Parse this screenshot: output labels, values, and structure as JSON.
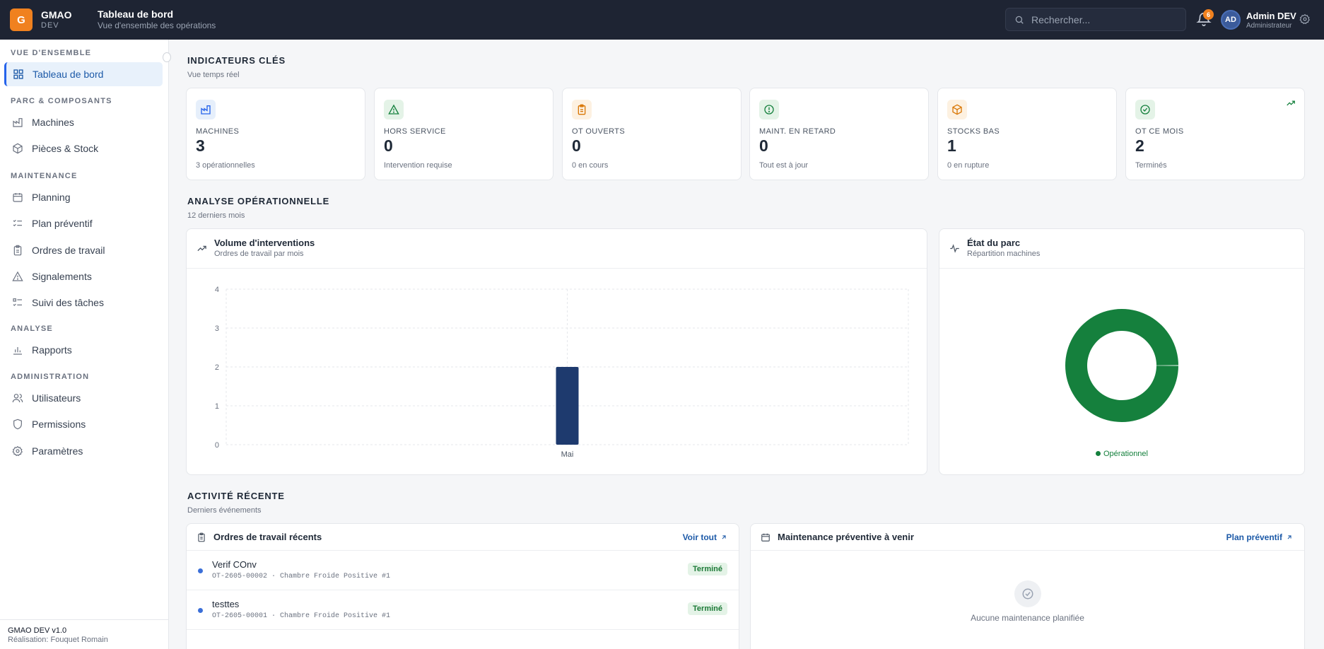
{
  "brand": {
    "logo_letter": "G",
    "name": "GMAO",
    "env": "DEV"
  },
  "header": {
    "title": "Tableau de bord",
    "subtitle": "Vue d'ensemble des opérations"
  },
  "search": {
    "placeholder": "Rechercher..."
  },
  "notifications": {
    "count": "6"
  },
  "user": {
    "initials": "AD",
    "name": "Admin DEV",
    "role": "Administrateur"
  },
  "sidebar": {
    "sections": [
      {
        "title": "VUE D'ENSEMBLE",
        "items": [
          {
            "label": "Tableau de bord",
            "icon": "dashboard-icon",
            "active": true
          }
        ]
      },
      {
        "title": "PARC & COMPOSANTS",
        "items": [
          {
            "label": "Machines",
            "icon": "factory-icon"
          },
          {
            "label": "Pièces & Stock",
            "icon": "box-icon"
          }
        ]
      },
      {
        "title": "MAINTENANCE",
        "items": [
          {
            "label": "Planning",
            "icon": "calendar-icon"
          },
          {
            "label": "Plan préventif",
            "icon": "checklist-icon"
          },
          {
            "label": "Ordres de travail",
            "icon": "clipboard-icon"
          },
          {
            "label": "Signalements",
            "icon": "warning-icon"
          },
          {
            "label": "Suivi des tâches",
            "icon": "tasks-icon"
          }
        ]
      },
      {
        "title": "ANALYSE",
        "items": [
          {
            "label": "Rapports",
            "icon": "bar-chart-icon"
          }
        ]
      },
      {
        "title": "ADMINISTRATION",
        "items": [
          {
            "label": "Utilisateurs",
            "icon": "users-icon"
          },
          {
            "label": "Permissions",
            "icon": "shield-icon"
          },
          {
            "label": "Paramètres",
            "icon": "gear-icon"
          }
        ]
      }
    ],
    "footer": {
      "version": "GMAO DEV v1.0",
      "credit": "Réalisation: Fouquet Romain"
    }
  },
  "kpi_section": {
    "title": "INDICATEURS CLÉS",
    "subtitle": "Vue temps réel"
  },
  "kpis": [
    {
      "label": "MACHINES",
      "value": "3",
      "sub": "3 opérationnelles",
      "icon": "factory-icon",
      "color": "#2563eb",
      "bg": "#e6effb"
    },
    {
      "label": "HORS SERVICE",
      "value": "0",
      "sub": "Intervention requise",
      "icon": "warning-icon",
      "color": "#15803d",
      "bg": "#e4f3e7"
    },
    {
      "label": "OT OUVERTS",
      "value": "0",
      "sub": "0 en cours",
      "icon": "clipboard-icon",
      "color": "#d97706",
      "bg": "#fdf1e1"
    },
    {
      "label": "MAINT. EN RETARD",
      "value": "0",
      "sub": "Tout est à jour",
      "icon": "alert-circle-icon",
      "color": "#15803d",
      "bg": "#e4f3e7"
    },
    {
      "label": "STOCKS BAS",
      "value": "1",
      "sub": "0 en rupture",
      "icon": "box-icon",
      "color": "#d97706",
      "bg": "#fdf1e1"
    },
    {
      "label": "OT CE MOIS",
      "value": "2",
      "sub": "Terminés",
      "icon": "check-circle-icon",
      "color": "#15803d",
      "bg": "#e4f3e7"
    }
  ],
  "analysis_section": {
    "title": "ANALYSE OPÉRATIONNELLE",
    "subtitle": "12 derniers mois"
  },
  "volume_card": {
    "title": "Volume d'interventions",
    "subtitle": "Ordres de travail par mois"
  },
  "parc_card": {
    "title": "État du parc",
    "subtitle": "Répartition machines",
    "legend": "Opérationnel"
  },
  "chart_data": [
    {
      "type": "bar",
      "title": "Volume d'interventions",
      "categories": [
        "Mai"
      ],
      "values": [
        2
      ],
      "ylim": [
        0,
        4
      ],
      "yticks": [
        0,
        1,
        2,
        3,
        4
      ],
      "grid": true,
      "color": "#1e3a6e"
    },
    {
      "type": "pie",
      "title": "État du parc",
      "labels": [
        "Opérationnel"
      ],
      "values": [
        3
      ],
      "colors": [
        "#15803d"
      ],
      "donut": true,
      "legend_position": "bottom"
    }
  ],
  "activity_section": {
    "title": "ACTIVITÉ RÉCENTE",
    "subtitle": "Derniers événements"
  },
  "work_orders_card": {
    "title": "Ordres de travail récents",
    "link": "Voir tout",
    "rows": [
      {
        "title": "Verif COnv",
        "meta": "OT-2605-00002 · Chambre Froide Positive #1",
        "status": "Terminé"
      },
      {
        "title": "testtes",
        "meta": "OT-2605-00001 · Chambre Froide Positive #1",
        "status": "Terminé"
      }
    ]
  },
  "preventive_card": {
    "title": "Maintenance préventive à venir",
    "link": "Plan préventif",
    "empty": "Aucune maintenance planifiée"
  }
}
